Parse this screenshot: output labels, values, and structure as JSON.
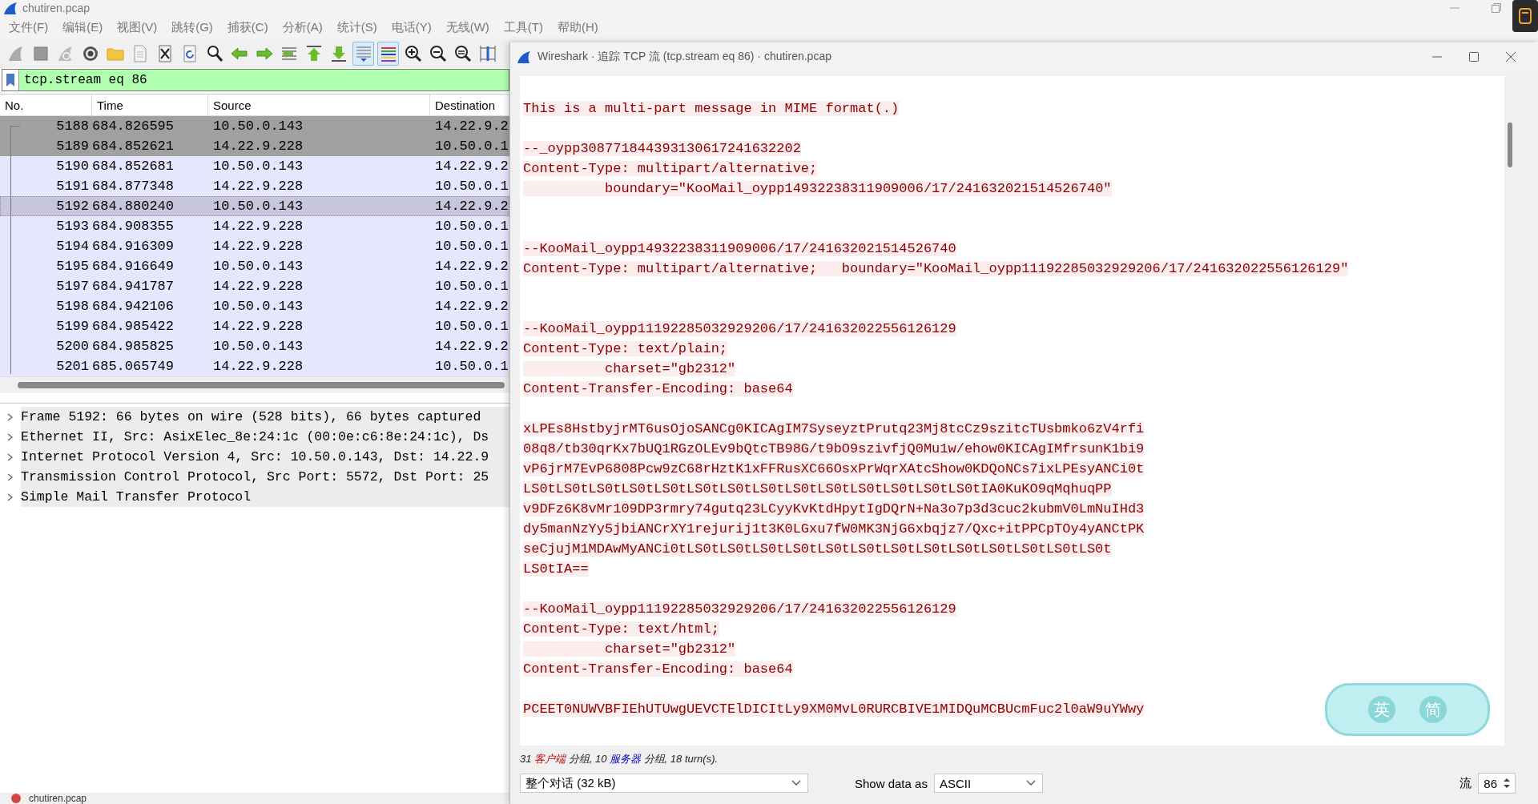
{
  "window": {
    "title": "chutiren.pcap"
  },
  "menu": [
    "文件(F)",
    "编辑(E)",
    "视图(V)",
    "跳转(G)",
    "捕获(C)",
    "分析(A)",
    "统计(S)",
    "电话(Y)",
    "无线(W)",
    "工具(T)",
    "帮助(H)"
  ],
  "toolbar": [
    {
      "kind": "start",
      "on": false
    },
    {
      "kind": "stop",
      "on": false
    },
    {
      "kind": "restart",
      "on": false
    },
    {
      "kind": "options",
      "on": false
    },
    {
      "kind": "open",
      "on": false
    },
    {
      "kind": "save",
      "on": false
    },
    {
      "kind": "close",
      "on": false
    },
    {
      "kind": "reload",
      "on": false
    },
    {
      "kind": "find",
      "on": false
    },
    {
      "kind": "back",
      "on": false
    },
    {
      "kind": "forward",
      "on": false
    },
    {
      "kind": "goto",
      "on": false
    },
    {
      "kind": "first",
      "on": false
    },
    {
      "kind": "last",
      "on": false
    },
    {
      "kind": "autoscroll",
      "on": true
    },
    {
      "kind": "colorize",
      "on": true
    },
    {
      "kind": "zoom-in",
      "on": false
    },
    {
      "kind": "zoom-out",
      "on": false
    },
    {
      "kind": "zoom-normal",
      "on": false
    },
    {
      "kind": "resize",
      "on": false
    }
  ],
  "filter": {
    "value": "tcp.stream eq 86"
  },
  "packet_list": {
    "columns": [
      "No.",
      "Time",
      "Source",
      "Destination"
    ],
    "rows": [
      {
        "no": "5188",
        "time": "684.826595",
        "source": "10.50.0.143",
        "destination": "14.22.9.2",
        "color": "#a0a0a0",
        "selected": false
      },
      {
        "no": "5189",
        "time": "684.852621",
        "source": "14.22.9.228",
        "destination": "10.50.0.1",
        "color": "#a0a0a0",
        "selected": false
      },
      {
        "no": "5190",
        "time": "684.852681",
        "source": "10.50.0.143",
        "destination": "14.22.9.2",
        "color": "#e7e6ff",
        "selected": false
      },
      {
        "no": "5191",
        "time": "684.877348",
        "source": "14.22.9.228",
        "destination": "10.50.0.1",
        "color": "#e7e6ff",
        "selected": false
      },
      {
        "no": "5192",
        "time": "684.880240",
        "source": "10.50.0.143",
        "destination": "14.22.9.2",
        "color": "#c8c6dc",
        "selected": true
      },
      {
        "no": "5193",
        "time": "684.908355",
        "source": "14.22.9.228",
        "destination": "10.50.0.1",
        "color": "#e7e6ff",
        "selected": false
      },
      {
        "no": "5194",
        "time": "684.916309",
        "source": "14.22.9.228",
        "destination": "10.50.0.1",
        "color": "#e7e6ff",
        "selected": false
      },
      {
        "no": "5195",
        "time": "684.916649",
        "source": "10.50.0.143",
        "destination": "14.22.9.2",
        "color": "#e7e6ff",
        "selected": false
      },
      {
        "no": "5197",
        "time": "684.941787",
        "source": "14.22.9.228",
        "destination": "10.50.0.1",
        "color": "#e7e6ff",
        "selected": false
      },
      {
        "no": "5198",
        "time": "684.942106",
        "source": "10.50.0.143",
        "destination": "14.22.9.2",
        "color": "#e7e6ff",
        "selected": false
      },
      {
        "no": "5199",
        "time": "684.985422",
        "source": "14.22.9.228",
        "destination": "10.50.0.1",
        "color": "#e7e6ff",
        "selected": false
      },
      {
        "no": "5200",
        "time": "684.985825",
        "source": "10.50.0.143",
        "destination": "14.22.9.2",
        "color": "#e7e6ff",
        "selected": false
      },
      {
        "no": "5201",
        "time": "685.065749",
        "source": "14.22.9.228",
        "destination": "10.50.0.1",
        "color": "#e7e6ff",
        "selected": false
      }
    ]
  },
  "details": [
    {
      "text": "Frame 5192: 66 bytes on wire (528 bits), 66 bytes captured",
      "expanded": false
    },
    {
      "text": "Ethernet II, Src: AsixElec_8e:24:1c (00:0e:c6:8e:24:1c), Ds",
      "expanded": false
    },
    {
      "text": "Internet Protocol Version 4, Src: 10.50.0.143, Dst: 14.22.9",
      "expanded": false
    },
    {
      "text": "Transmission Control Protocol, Src Port: 5572, Dst Port: 25",
      "expanded": false
    },
    {
      "text": "Simple Mail Transfer Protocol",
      "expanded": false
    }
  ],
  "status_bar": {
    "file": "chutiren.pcap"
  },
  "dialog": {
    "title": "Wireshark · 追踪 TCP 流 (tcp.stream eq 86) · chutiren.pcap",
    "stream": [
      {
        "kind": "client",
        "lines": [
          "This is a multi-part message in MIME format(.)"
        ]
      },
      {
        "kind": "blank"
      },
      {
        "kind": "client",
        "lines": [
          "--_oypp308771844393130617241632202",
          "Content-Type: multipart/alternative;",
          "\tboundary=\"KooMail_oypp14932238311909006/17/241632021514526740\""
        ]
      },
      {
        "kind": "blank"
      },
      {
        "kind": "blank"
      },
      {
        "kind": "client",
        "lines": [
          "--KooMail_oypp14932238311909006/17/241632021514526740",
          "Content-Type: multipart/alternative;   boundary=\"KooMail_oypp11192285032929206/17/241632022556126129\""
        ]
      },
      {
        "kind": "blank"
      },
      {
        "kind": "blank"
      },
      {
        "kind": "client",
        "lines": [
          "--KooMail_oypp11192285032929206/17/241632022556126129",
          "Content-Type: text/plain;",
          "\tcharset=\"gb2312\"",
          "Content-Transfer-Encoding: base64"
        ]
      },
      {
        "kind": "blank"
      },
      {
        "kind": "client",
        "lines": [
          "xLPEs8HstbyjrMT6usOjoSANCg0KICAgIM7SyseyztPrutq23Mj8tcCz9szitcTUsbmko6zV4rfi",
          "08q8/tb30qrKx7bUQ1RGzOLEv9bQtcTB98G/t9bO9szivfjQ0Mu1w/ehow0KICAgIMfrsunK1bi9",
          "vP6jrM7EvP6808Pcw9zC68rHztK1xFFRusXC66OsxPrWqrXAtcShow0KDQoNCs7ixLPEsyANCi0t",
          "LS0tLS0tLS0tLS0tLS0tLS0tLS0tLS0tLS0tLS0tLS0tLS0tLS0tLS0tIA0KuKO9qMqhuqPP",
          "v9DFz6K8vMr109DP3rmry74gutq23LCyyKvKtdHpytIgDQrN+Na3o7p3d3cuc2kubmV0LmNuIHd3",
          "dy5manNzYy5jbiANCrXY1rejurij1t3K0LGxu7fW0MK3NjG6xbqjz7/Qxc+itPPCpTOy4yANCtPK",
          "seCjujM1MDAwMyANCi0tLS0tLS0tLS0tLS0tLS0tLS0tLS0tLS0tLS0tLS0tLS0tLS0tLS0t",
          "LS0tIA=="
        ]
      },
      {
        "kind": "blank"
      },
      {
        "kind": "client",
        "lines": [
          "--KooMail_oypp11192285032929206/17/241632022556126129",
          "Content-Type: text/html;",
          "\tcharset=\"gb2312\"",
          "Content-Transfer-Encoding: base64"
        ]
      },
      {
        "kind": "blank"
      },
      {
        "kind": "client",
        "lines": [
          "PCEET0NUWVBFIEhUTUwgUEVCTElDICItLy9XM0MvL0RURCBIVE1MIDQuMCBUcmFuc2l0aW9uYWwy"
        ]
      }
    ],
    "summary": [
      {
        "kind": "plain",
        "text": "31 "
      },
      {
        "kind": "client",
        "text": "客户端"
      },
      {
        "kind": "plain",
        "text": " 分组, 10 "
      },
      {
        "kind": "server",
        "text": "服务器"
      },
      {
        "kind": "plain",
        "text": " 分组, 18 turn(s)."
      }
    ],
    "conversation": "整个对话 (32 kB)",
    "show_label": "Show data as",
    "format": "ASCII",
    "stream_label": "流",
    "stream_number": "86"
  },
  "ime_bar": [
    "英",
    "简"
  ]
}
